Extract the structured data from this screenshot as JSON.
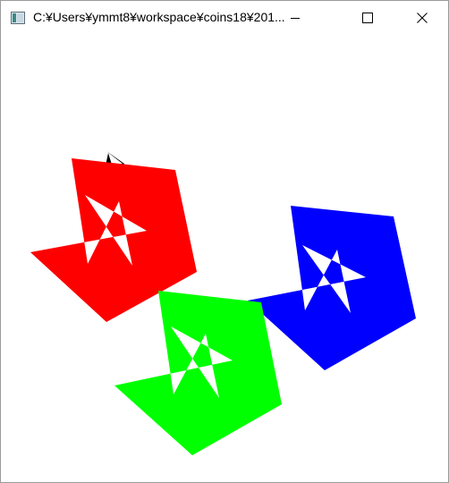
{
  "window": {
    "title": "C:¥Users¥ymmt8¥workspace¥coins18¥201...",
    "icon": "console-app-icon",
    "controls": [
      "minimize-icon",
      "maximize-icon",
      "close-icon"
    ]
  },
  "canvas": {
    "background": "#ffffff",
    "stars": [
      {
        "name": "small-black-star",
        "color": "#000000"
      },
      {
        "name": "red-star",
        "color": "#ff0000"
      },
      {
        "name": "blue-star",
        "color": "#0000ff"
      },
      {
        "name": "green-star",
        "color": "#00ff00"
      }
    ]
  }
}
